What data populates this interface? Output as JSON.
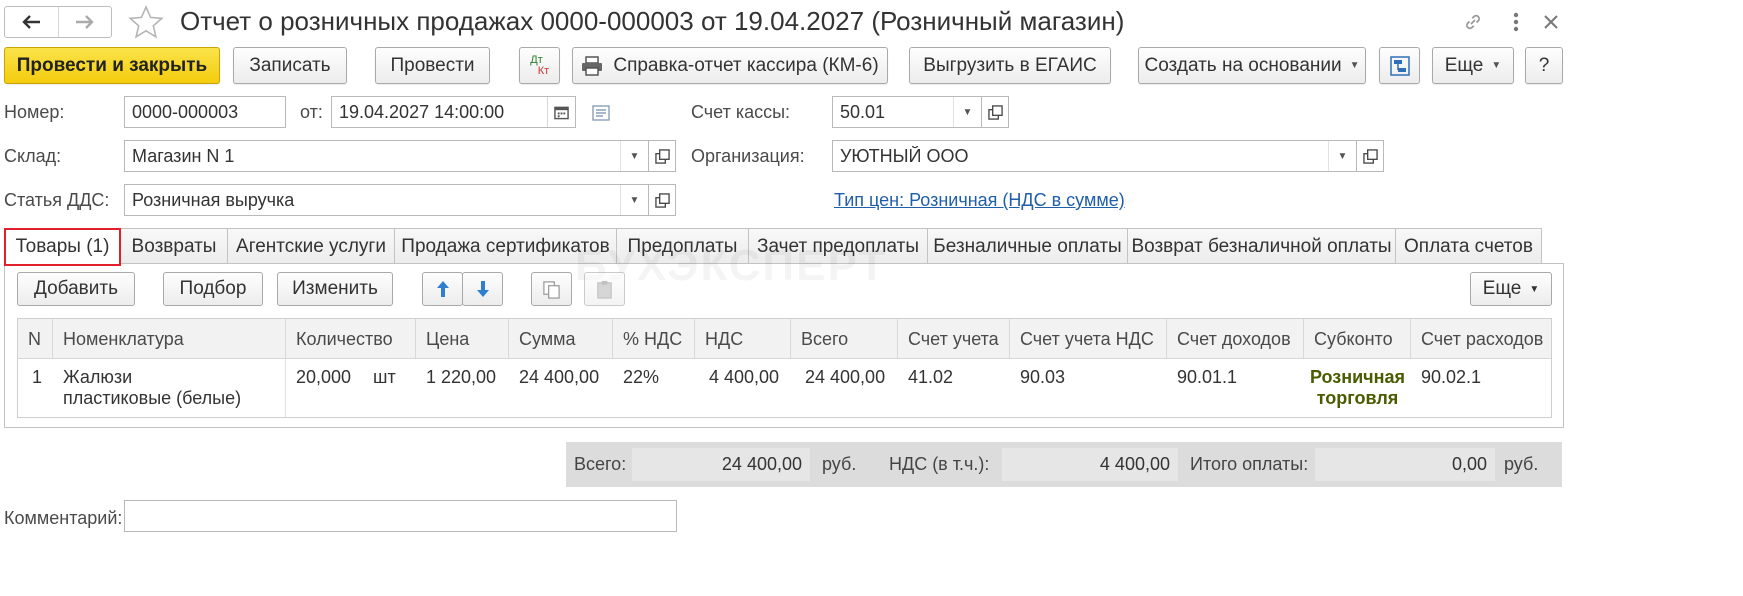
{
  "title": "Отчет о розничных продажах 0000-000003 от 19.04.2027 (Розничный магазин)",
  "toolbar": {
    "post_close": "Провести и закрыть",
    "save": "Записать",
    "post": "Провести",
    "dtkt_top": "Дт",
    "dtkt_bottom": "Кт",
    "cashier_report": "Справка-отчет кассира (КМ-6)",
    "egais": "Выгрузить в ЕГАИС",
    "create_based": "Создать на основании",
    "more": "Еще",
    "help": "?"
  },
  "form": {
    "number_label": "Номер:",
    "number_value": "0000-000003",
    "date_label": "от:",
    "date_value": "19.04.2027 14:00:00",
    "cash_account_label": "Счет кассы:",
    "cash_account_value": "50.01",
    "warehouse_label": "Склад:",
    "warehouse_value": "Магазин N 1",
    "org_label": "Организация:",
    "org_value": "УЮТНЫЙ ООО",
    "dds_label": "Статья ДДС:",
    "dds_value": "Розничная выручка",
    "price_type_link": "Тип цен: Розничная (НДС в сумме)"
  },
  "tabs": [
    "Товары (1)",
    "Возвраты",
    "Агентские услуги",
    "Продажа сертификатов",
    "Предоплаты",
    "Зачет предоплаты",
    "Безналичные оплаты",
    "Возврат безналичной оплаты",
    "Оплата счетов"
  ],
  "tab_toolbar": {
    "add": "Добавить",
    "pick": "Подбор",
    "change": "Изменить",
    "more": "Еще"
  },
  "watermark": "БУХЭКСПЕРТ",
  "table": {
    "columns": [
      "N",
      "Номенклатура",
      "Количество",
      "Цена",
      "Сумма",
      "% НДС",
      "НДС",
      "Всего",
      "Счет учета",
      "Счет учета НДС",
      "Счет доходов",
      "Субконто",
      "Счет расходов"
    ],
    "rows": [
      {
        "n": "1",
        "name_line1": "Жалюзи",
        "name_line2": "пластиковые (белые)",
        "qty": "20,000",
        "unit": "шт",
        "price": "1 220,00",
        "sum": "24 400,00",
        "vat_rate": "22%",
        "vat": "4 400,00",
        "total": "24 400,00",
        "account": "41.02",
        "vat_account": "90.03",
        "income_account": "90.01.1",
        "subconto_line1": "Розничная",
        "subconto_line2": "торговля",
        "expense_account": "90.02.1"
      }
    ]
  },
  "totals": {
    "total_label": "Всего:",
    "total_value": "24 400,00",
    "currency1": "руб.",
    "vat_label": "НДС (в т.ч.):",
    "vat_value": "4 400,00",
    "paid_label": "Итого оплаты:",
    "paid_value": "0,00",
    "currency2": "руб."
  },
  "comment_label": "Комментарий:",
  "comment_value": ""
}
